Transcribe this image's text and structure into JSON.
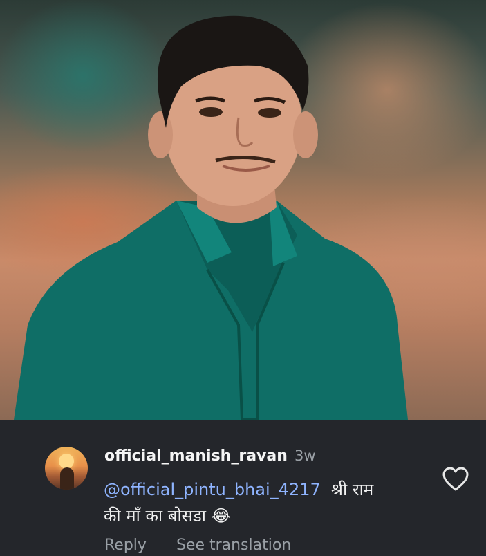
{
  "comment": {
    "username": "official_manish_ravan",
    "time": "3w",
    "mention": "@official_pintu_bhai_4217",
    "text_line1": "श्री राम",
    "text_line2": "की माँ का बोसडा",
    "emoji": "😂",
    "reply_label": "Reply",
    "translate_label": "See translation"
  }
}
